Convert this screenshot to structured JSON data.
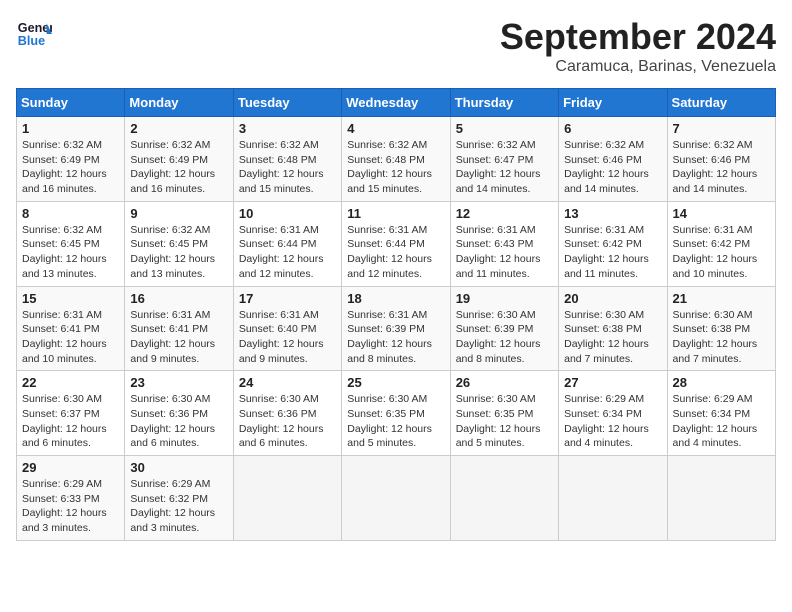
{
  "header": {
    "logo_line1": "General",
    "logo_line2": "Blue",
    "month": "September 2024",
    "location": "Caramuca, Barinas, Venezuela"
  },
  "weekdays": [
    "Sunday",
    "Monday",
    "Tuesday",
    "Wednesday",
    "Thursday",
    "Friday",
    "Saturday"
  ],
  "weeks": [
    [
      {
        "day": "1",
        "info": "Sunrise: 6:32 AM\nSunset: 6:49 PM\nDaylight: 12 hours\nand 16 minutes."
      },
      {
        "day": "2",
        "info": "Sunrise: 6:32 AM\nSunset: 6:49 PM\nDaylight: 12 hours\nand 16 minutes."
      },
      {
        "day": "3",
        "info": "Sunrise: 6:32 AM\nSunset: 6:48 PM\nDaylight: 12 hours\nand 15 minutes."
      },
      {
        "day": "4",
        "info": "Sunrise: 6:32 AM\nSunset: 6:48 PM\nDaylight: 12 hours\nand 15 minutes."
      },
      {
        "day": "5",
        "info": "Sunrise: 6:32 AM\nSunset: 6:47 PM\nDaylight: 12 hours\nand 14 minutes."
      },
      {
        "day": "6",
        "info": "Sunrise: 6:32 AM\nSunset: 6:46 PM\nDaylight: 12 hours\nand 14 minutes."
      },
      {
        "day": "7",
        "info": "Sunrise: 6:32 AM\nSunset: 6:46 PM\nDaylight: 12 hours\nand 14 minutes."
      }
    ],
    [
      {
        "day": "8",
        "info": "Sunrise: 6:32 AM\nSunset: 6:45 PM\nDaylight: 12 hours\nand 13 minutes."
      },
      {
        "day": "9",
        "info": "Sunrise: 6:32 AM\nSunset: 6:45 PM\nDaylight: 12 hours\nand 13 minutes."
      },
      {
        "day": "10",
        "info": "Sunrise: 6:31 AM\nSunset: 6:44 PM\nDaylight: 12 hours\nand 12 minutes."
      },
      {
        "day": "11",
        "info": "Sunrise: 6:31 AM\nSunset: 6:44 PM\nDaylight: 12 hours\nand 12 minutes."
      },
      {
        "day": "12",
        "info": "Sunrise: 6:31 AM\nSunset: 6:43 PM\nDaylight: 12 hours\nand 11 minutes."
      },
      {
        "day": "13",
        "info": "Sunrise: 6:31 AM\nSunset: 6:42 PM\nDaylight: 12 hours\nand 11 minutes."
      },
      {
        "day": "14",
        "info": "Sunrise: 6:31 AM\nSunset: 6:42 PM\nDaylight: 12 hours\nand 10 minutes."
      }
    ],
    [
      {
        "day": "15",
        "info": "Sunrise: 6:31 AM\nSunset: 6:41 PM\nDaylight: 12 hours\nand 10 minutes."
      },
      {
        "day": "16",
        "info": "Sunrise: 6:31 AM\nSunset: 6:41 PM\nDaylight: 12 hours\nand 9 minutes."
      },
      {
        "day": "17",
        "info": "Sunrise: 6:31 AM\nSunset: 6:40 PM\nDaylight: 12 hours\nand 9 minutes."
      },
      {
        "day": "18",
        "info": "Sunrise: 6:31 AM\nSunset: 6:39 PM\nDaylight: 12 hours\nand 8 minutes."
      },
      {
        "day": "19",
        "info": "Sunrise: 6:30 AM\nSunset: 6:39 PM\nDaylight: 12 hours\nand 8 minutes."
      },
      {
        "day": "20",
        "info": "Sunrise: 6:30 AM\nSunset: 6:38 PM\nDaylight: 12 hours\nand 7 minutes."
      },
      {
        "day": "21",
        "info": "Sunrise: 6:30 AM\nSunset: 6:38 PM\nDaylight: 12 hours\nand 7 minutes."
      }
    ],
    [
      {
        "day": "22",
        "info": "Sunrise: 6:30 AM\nSunset: 6:37 PM\nDaylight: 12 hours\nand 6 minutes."
      },
      {
        "day": "23",
        "info": "Sunrise: 6:30 AM\nSunset: 6:36 PM\nDaylight: 12 hours\nand 6 minutes."
      },
      {
        "day": "24",
        "info": "Sunrise: 6:30 AM\nSunset: 6:36 PM\nDaylight: 12 hours\nand 6 minutes."
      },
      {
        "day": "25",
        "info": "Sunrise: 6:30 AM\nSunset: 6:35 PM\nDaylight: 12 hours\nand 5 minutes."
      },
      {
        "day": "26",
        "info": "Sunrise: 6:30 AM\nSunset: 6:35 PM\nDaylight: 12 hours\nand 5 minutes."
      },
      {
        "day": "27",
        "info": "Sunrise: 6:29 AM\nSunset: 6:34 PM\nDaylight: 12 hours\nand 4 minutes."
      },
      {
        "day": "28",
        "info": "Sunrise: 6:29 AM\nSunset: 6:34 PM\nDaylight: 12 hours\nand 4 minutes."
      }
    ],
    [
      {
        "day": "29",
        "info": "Sunrise: 6:29 AM\nSunset: 6:33 PM\nDaylight: 12 hours\nand 3 minutes."
      },
      {
        "day": "30",
        "info": "Sunrise: 6:29 AM\nSunset: 6:32 PM\nDaylight: 12 hours\nand 3 minutes."
      },
      {
        "day": "",
        "info": ""
      },
      {
        "day": "",
        "info": ""
      },
      {
        "day": "",
        "info": ""
      },
      {
        "day": "",
        "info": ""
      },
      {
        "day": "",
        "info": ""
      }
    ]
  ]
}
